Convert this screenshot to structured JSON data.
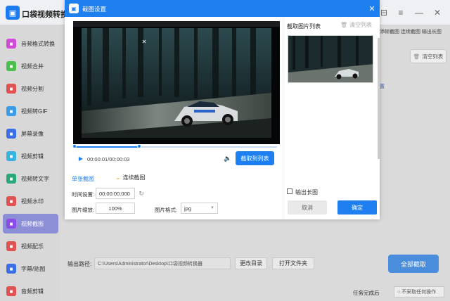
{
  "app": {
    "title": "口袋视频转换器",
    "logo_glyph": "▣",
    "window_controls": [
      "⊟",
      "≡",
      "—",
      "✕"
    ]
  },
  "sidebar": {
    "items": [
      {
        "label": "音频格式转换",
        "icon": "music-icon",
        "color": "#d04bd6"
      },
      {
        "label": "视频合并",
        "icon": "merge-icon",
        "color": "#4bbf4b"
      },
      {
        "label": "视频分割",
        "icon": "split-icon",
        "color": "#e05252"
      },
      {
        "label": "视频转GIF",
        "icon": "gif-icon",
        "color": "#3a9be8"
      },
      {
        "label": "屏幕录像",
        "icon": "record-icon",
        "color": "#3a6fe8"
      },
      {
        "label": "视频剪辑",
        "icon": "scissors-icon",
        "color": "#38b3e0"
      },
      {
        "label": "视频转文字",
        "icon": "text-icon",
        "color": "#2aa87a"
      },
      {
        "label": "视频水印",
        "icon": "watermark-icon",
        "color": "#e05252"
      },
      {
        "label": "视频截图",
        "icon": "screenshot-icon",
        "color": "#8a4be6",
        "active": true
      },
      {
        "label": "视频配乐",
        "icon": "audio-icon",
        "color": "#e05252"
      },
      {
        "label": "字幕/贴图",
        "icon": "subtitle-icon",
        "color": "#3a6fe8"
      },
      {
        "label": "音频剪辑",
        "icon": "audio-cut-icon",
        "color": "#e05252"
      }
    ]
  },
  "main": {
    "top_tabs": "添帧截图  连续截图  输出长图",
    "clear_list": "清空列表",
    "behind_link": "置",
    "output_label": "输出路径:",
    "output_path": "C:\\Users\\Administrator\\Desktop\\口袋视频转换器",
    "change_dir": "更改目录",
    "open_folder": "打开文件夹",
    "capture_all": "全部截取",
    "after_done_label": "任务完成后",
    "after_done_value": "○ 不采取任何操作"
  },
  "dialog": {
    "title": "截图设置",
    "close": "✕",
    "player": {
      "time": "00:00:01/00:00:03",
      "progress": 0.32,
      "play_glyph": "▶",
      "volume_glyph": "🔈"
    },
    "capture_button": "截取到列表",
    "tabs": {
      "single": "单张截图",
      "continuous": "连续截图"
    },
    "fields": {
      "time_label": "时间设置:",
      "time_value": "00:00:00.000",
      "zoom_label": "图片缩放:",
      "zoom_value": "100%",
      "format_label": "图片格式:",
      "format_value": "jpg"
    },
    "list": {
      "title": "截取图片列表",
      "clear": "清空列表",
      "thumb_close": "✕"
    },
    "long_image_label": "输出长图",
    "cancel": "取消",
    "confirm": "确定"
  },
  "colors": {
    "accent": "#1e7ff0",
    "sidebar_active": "#8d8fd6",
    "capture_all": "#4a8ddc"
  }
}
